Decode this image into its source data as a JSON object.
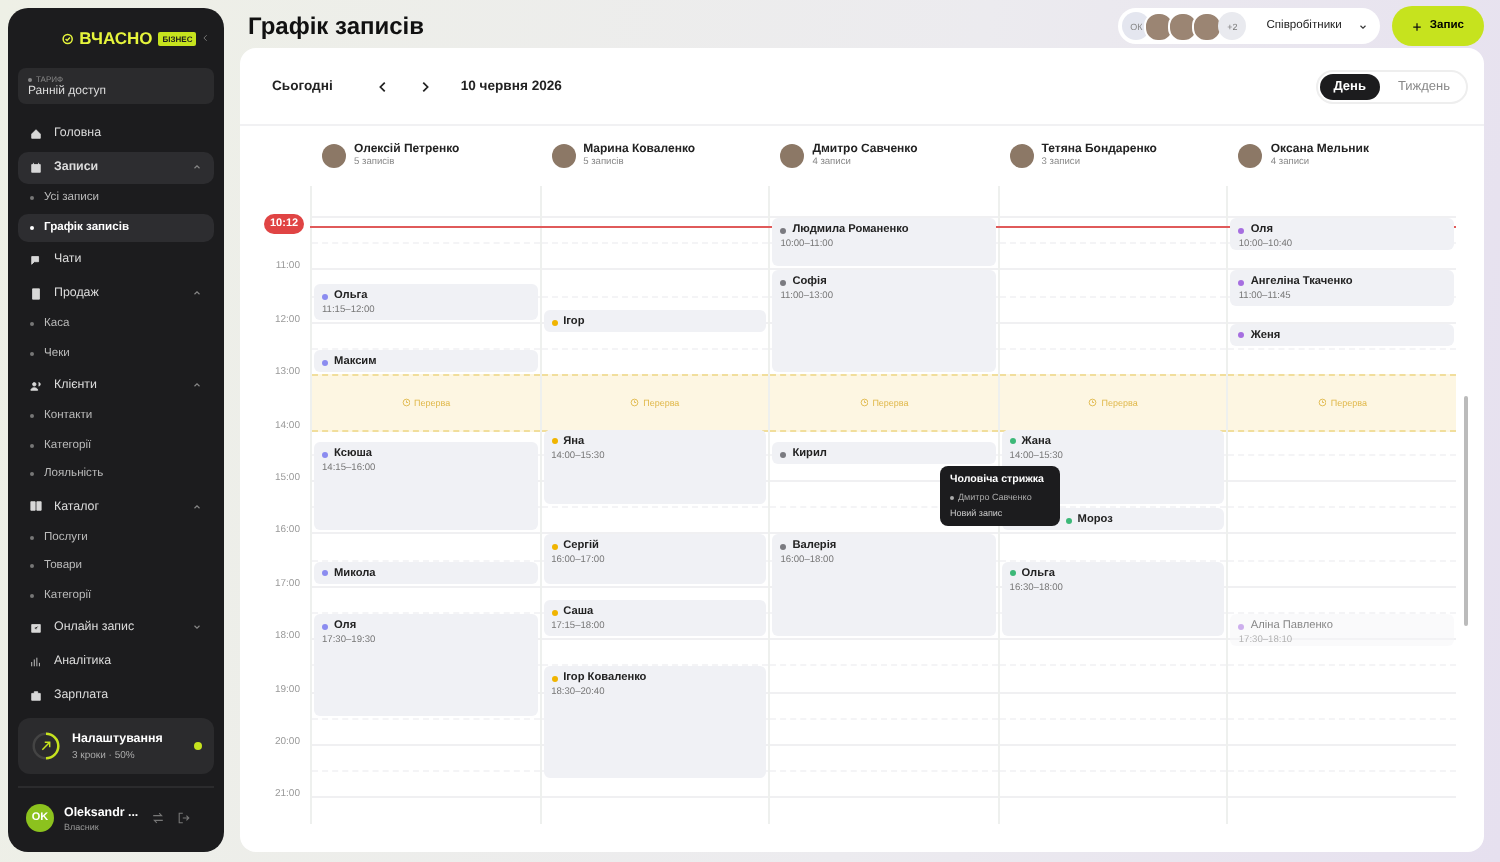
{
  "sidebar": {
    "logo": "ВЧАСНО",
    "logo_badge": "БІЗНЕС",
    "tariff": {
      "label": "ТАРИФ",
      "value": "Ранній доступ"
    },
    "nav": [
      {
        "label": "Головна",
        "selected": false
      },
      {
        "label": "Записи",
        "selected": true,
        "expanded": true,
        "children": [
          {
            "label": "Усі записи",
            "selected": false
          },
          {
            "label": "Графік записів",
            "selected": true
          }
        ]
      },
      {
        "label": "Чати",
        "selected": false
      },
      {
        "label": "Продаж",
        "selected": false,
        "expanded": true,
        "children": [
          {
            "label": "Каса",
            "selected": false
          },
          {
            "label": "Чеки",
            "selected": false
          }
        ]
      },
      {
        "label": "Клієнти",
        "selected": false,
        "expanded": true,
        "children": [
          {
            "label": "Контакти",
            "selected": false
          },
          {
            "label": "Категорії",
            "selected": false
          },
          {
            "label": "Лояльність",
            "selected": false
          }
        ]
      },
      {
        "label": "Каталог",
        "selected": false,
        "expanded": true,
        "children": [
          {
            "label": "Послуги",
            "selected": false
          },
          {
            "label": "Товари",
            "selected": false
          },
          {
            "label": "Категорії",
            "selected": false
          }
        ]
      },
      {
        "label": "Онлайн запис",
        "selected": false,
        "expanded": false
      },
      {
        "label": "Аналітика",
        "selected": false
      },
      {
        "label": "Зарплата",
        "selected": false
      }
    ],
    "setup": {
      "title": "Налаштування",
      "subtitle": "3 кроки · 50%",
      "level": 0.5
    },
    "user": {
      "initials": "OK",
      "name": "Oleksandr ...",
      "role": "Власник"
    }
  },
  "header": {
    "title": "Графік записів",
    "staff_picker": {
      "initials": "ОК",
      "more": "+2",
      "label": "Співробітники"
    },
    "add_button": "Запис"
  },
  "toolbar": {
    "today": "Сьогодні",
    "date": "10 червня 2026",
    "views": [
      {
        "label": "День",
        "selected": true
      },
      {
        "label": "Тиждень",
        "selected": false
      }
    ]
  },
  "calendar": {
    "now": "10:12",
    "hours": [
      "11:00",
      "12:00",
      "13:00",
      "14:00",
      "15:00",
      "16:00",
      "17:00",
      "18:00",
      "19:00",
      "20:00",
      "21:00"
    ],
    "staff": [
      {
        "name": "Олексій Петренко",
        "count": "5 записів",
        "color": "#8b8cf0",
        "break_label": "Перерва",
        "events": [
          {
            "name": "Ольга",
            "time": "11:15–12:00",
            "draft": false
          },
          {
            "name": "Максим",
            "draft": false
          },
          {
            "name": "Ксюша",
            "time": "14:15–16:00",
            "draft": false
          },
          {
            "name": "Микола",
            "draft": false
          },
          {
            "name": "Оля",
            "time": "17:30–19:30",
            "draft": false
          }
        ]
      },
      {
        "name": "Марина Коваленко",
        "count": "5 записів",
        "color": "#f0b400",
        "break_label": "Перерва",
        "events": [
          {
            "name": "Ігор",
            "draft": false
          },
          {
            "name": "Яна",
            "time": "14:00–15:30",
            "draft": false
          },
          {
            "name": "Сергій",
            "time": "16:00–17:00",
            "draft": false
          },
          {
            "name": "Саша",
            "time": "17:15–18:00",
            "draft": false
          },
          {
            "name": "Ігор Коваленко",
            "time": "18:30–20:40",
            "draft": false
          }
        ]
      },
      {
        "name": "Дмитро Савченко",
        "count": "4 записи",
        "color": "#7a7a80",
        "break_label": "Перерва",
        "events": [
          {
            "name": "Людмила Романенко",
            "time": "10:00–11:00",
            "draft": false
          },
          {
            "name": "Софія",
            "time": "11:00–13:00",
            "draft": false
          },
          {
            "name": "Кирил",
            "draft": false
          },
          {
            "name": "Валерія",
            "time": "16:00–18:00",
            "draft": false
          }
        ]
      },
      {
        "name": "Тетяна Бондаренко",
        "count": "3 записи",
        "color": "#3cb878",
        "break_label": "Перерва",
        "events": [
          {
            "name": "Жана",
            "time": "14:00–15:30",
            "draft": false
          },
          {
            "name": "Мороз",
            "draft": false,
            "covered": true
          },
          {
            "name": "Ольга",
            "time": "16:30–18:00",
            "draft": false
          }
        ]
      },
      {
        "name": "Оксана Мельник",
        "count": "4 записи",
        "color": "#a66ee0",
        "break_label": "Перерва",
        "events": [
          {
            "name": "Оля",
            "time": "10:00–10:40",
            "draft": false
          },
          {
            "name": "Ангеліна Ткаченко",
            "time": "11:00–11:45",
            "draft": false
          },
          {
            "name": "Женя",
            "draft": false
          },
          {
            "name": "Аліна Павленко",
            "time": "17:30–18:10",
            "draft": true
          }
        ]
      }
    ],
    "tooltip": {
      "title": "Чоловіча стрижка",
      "staff": "Дмитро Савченко",
      "note": "Новий запис"
    }
  }
}
